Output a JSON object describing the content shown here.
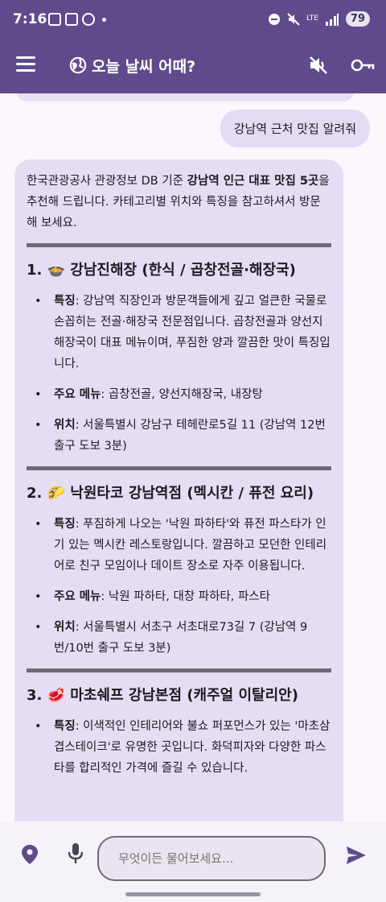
{
  "status_bar": {
    "time": "7:16",
    "network": "LTE",
    "battery": "79"
  },
  "toolbar": {
    "title": "오늘 날씨 어때?",
    "menu_icon": "menu-icon",
    "globe_icon": "globe-icon",
    "mute_icon": "volume-off-icon",
    "key_icon": "key-icon"
  },
  "chat": {
    "user_message": "강남역 근처 맛집 알려줘",
    "bot": {
      "intro_1": "한국관광공사 관광정보 DB 기준 ",
      "intro_bold": "강남역 인근 대표 맛집 5곳",
      "intro_2": "을 추천해 드립니다. 카테고리별 위치와 특징을 참고하셔서 방문해 보세요.",
      "sections": [
        {
          "title": "1. 🍲 강남진해장 (한식 / 곱창전골·해장국)",
          "items": [
            {
              "key": "특징",
              "text": ": 강남역 직장인과 방문객들에게 깊고 얼큰한 국물로 손꼽히는 전골·해장국 전문점입니다. 곱창전골과 양선지해장국이 대표 메뉴이며, 푸짐한 양과 깔끔한 맛이 특징입니다."
            },
            {
              "key": "주요 메뉴",
              "text": ": 곱창전골, 양선지해장국, 내장탕"
            },
            {
              "key": "위치",
              "text": ": 서울특별시 강남구 테헤란로5길 11 (강남역 12번 출구 도보 3분)"
            }
          ]
        },
        {
          "title": "2. 🌮 낙원타코 강남역점 (멕시칸 / 퓨전 요리)",
          "items": [
            {
              "key": "특징",
              "text": ": 푸짐하게 나오는 '낙원 파하타'와 퓨전 파스타가 인기 있는 멕시칸 레스토랑입니다. 깔끔하고 모던한 인테리어로 친구 모임이나 데이트 장소로 자주 이용됩니다."
            },
            {
              "key": "주요 메뉴",
              "text": ": 낙원 파하타, 대창 파하타, 파스타"
            },
            {
              "key": "위치",
              "text": ": 서울특별시 서초구 서초대로73길 7 (강남역 9번/10번 출구 도보 3분)"
            }
          ]
        },
        {
          "title": "3. 🥩 마초쉐프 강남본점 (캐주얼 이탈리안)",
          "items": [
            {
              "key": "특징",
              "text": ": 이색적인 인테리어와 불쇼 퍼포먼스가 있는 '마초삼겹스테이크'로 유명한 곳입니다. 화덕피자와 다양한 파스타를 합리적인 가격에 즐길 수 있습니다."
            }
          ]
        }
      ]
    }
  },
  "input": {
    "placeholder": "무엇이든 물어보세요..."
  },
  "colors": {
    "appbar": "#5f4b8b",
    "bubble": "#e5ddf4",
    "accent": "#5f4b8b"
  }
}
